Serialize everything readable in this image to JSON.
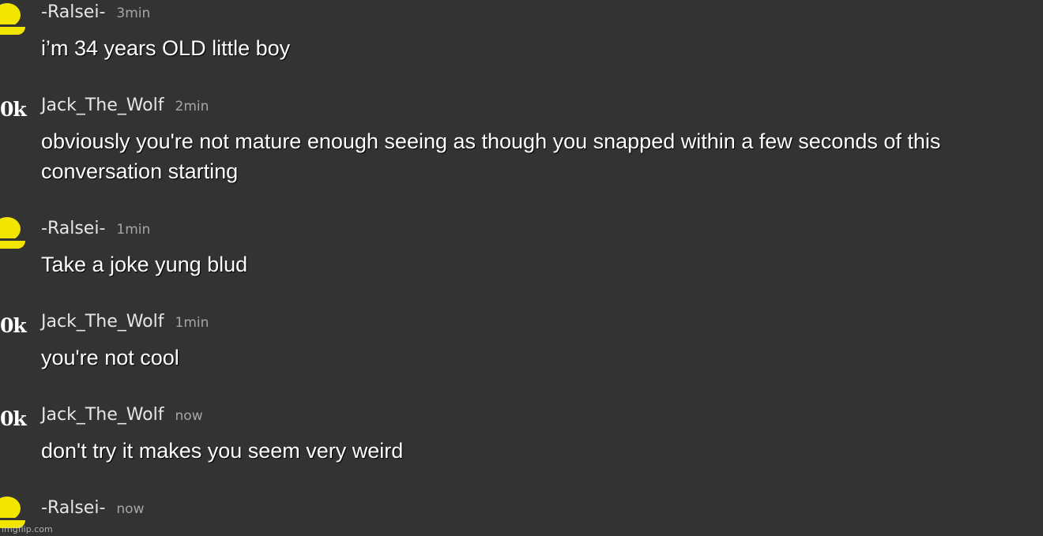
{
  "colors": {
    "background": "#333333",
    "message_text": "#ffffff",
    "username": "#e6e6e6",
    "timestamp": "#a6a6a6",
    "avatar_yellow": "#f2e600"
  },
  "messages": [
    {
      "username": "-Ralsei-",
      "time": "3min",
      "text": "i’m 34 years OLD little boy",
      "avatar_icon": "yellow-user-icon"
    },
    {
      "username": "Jack_The_Wolf",
      "time": "2min",
      "text": "obviously you're not mature enough seeing as though you snapped within a few seconds of this conversation starting",
      "avatar_icon": "ok-text-icon",
      "avatar_text": "0k"
    },
    {
      "username": "-Ralsei-",
      "time": "1min",
      "text": "Take a joke yung blud",
      "avatar_icon": "yellow-user-icon"
    },
    {
      "username": "Jack_The_Wolf",
      "time": "1min",
      "text": "you're not cool",
      "avatar_icon": "ok-text-icon",
      "avatar_text": "0k"
    },
    {
      "username": "Jack_The_Wolf",
      "time": "now",
      "text": "don't try it makes you seem very weird",
      "avatar_icon": "ok-text-icon",
      "avatar_text": "0k"
    },
    {
      "username": "-Ralsei-",
      "time": "now",
      "text": "",
      "avatar_icon": "yellow-user-icon"
    }
  ],
  "watermark": "imgflip.com"
}
